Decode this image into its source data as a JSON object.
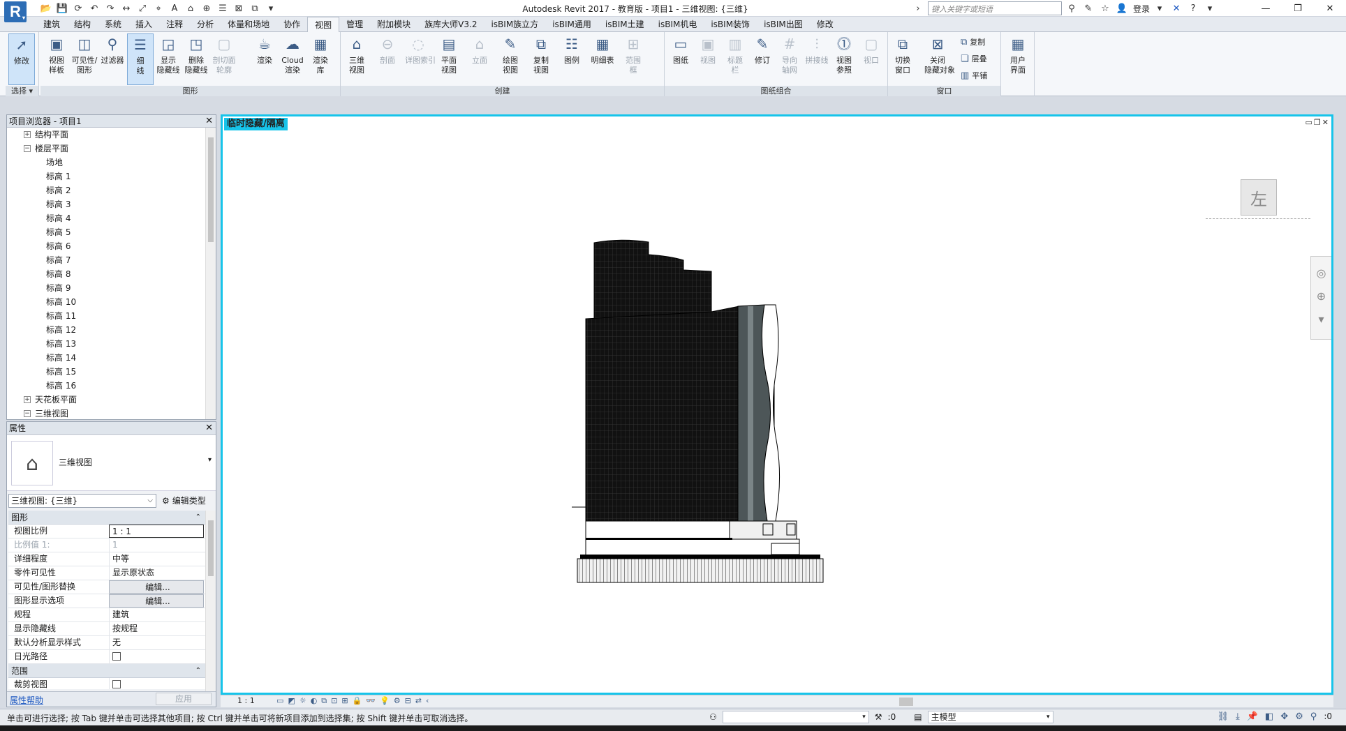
{
  "app": {
    "logo": "R",
    "window_title": "Autodesk Revit 2017 - 教育版 -    项目1 - 三维视图: {三维}",
    "search_placeholder": "键入关键字或短语",
    "login": "登录"
  },
  "tabs": [
    "建筑",
    "结构",
    "系统",
    "插入",
    "注释",
    "分析",
    "体量和场地",
    "协作",
    "视图",
    "管理",
    "附加模块",
    "族库大师V3.2",
    "isBIM族立方",
    "isBIM通用",
    "isBIM土建",
    "isBIM机电",
    "isBIM装饰",
    "isBIM出图",
    "修改"
  ],
  "active_tab": "视图",
  "ribbon": {
    "select_group": {
      "button": "修改",
      "title": "选择"
    },
    "graphics_group": {
      "title": "图形",
      "buttons": [
        {
          "label": "视图\n样板",
          "icon": "view-template-icon",
          "dim": false
        },
        {
          "label": "可见性/\n图形",
          "icon": "visibility-icon",
          "dim": false
        },
        {
          "label": "过滤器",
          "icon": "filter-icon",
          "dim": false
        },
        {
          "label": "细\n线",
          "icon": "thin-lines-icon",
          "dim": false,
          "active": true
        },
        {
          "label": "显示\n隐藏线",
          "icon": "show-hidden-icon",
          "dim": false
        },
        {
          "label": "删除\n隐藏线",
          "icon": "remove-hidden-icon",
          "dim": false
        },
        {
          "label": "剖切面\n轮廓",
          "icon": "cut-profile-icon",
          "dim": true
        }
      ]
    },
    "presentation_group": {
      "buttons": [
        {
          "label": "渲染",
          "icon": "render-icon",
          "dim": false
        },
        {
          "label": "Cloud\n渲染",
          "icon": "cloud-render-icon",
          "dim": false
        },
        {
          "label": "渲染\n库",
          "icon": "render-gallery-icon",
          "dim": false
        }
      ]
    },
    "create_group": {
      "title": "创建",
      "buttons": [
        {
          "label": "三维\n视图",
          "icon": "3d-view-icon",
          "dim": false
        },
        {
          "label": "剖面",
          "icon": "section-icon",
          "dim": true
        },
        {
          "label": "详图索引",
          "icon": "callout-icon",
          "dim": true
        },
        {
          "label": "平面\n视图",
          "icon": "plan-view-icon",
          "dim": false
        },
        {
          "label": "立面",
          "icon": "elevation-icon",
          "dim": true
        },
        {
          "label": "绘图\n视图",
          "icon": "drafting-view-icon",
          "dim": false
        },
        {
          "label": "复制\n视图",
          "icon": "duplicate-view-icon",
          "dim": false
        },
        {
          "label": "图例",
          "icon": "legend-icon",
          "dim": false
        },
        {
          "label": "明细表",
          "icon": "schedule-icon",
          "dim": false
        },
        {
          "label": "范围\n框",
          "icon": "scope-box-icon",
          "dim": true
        }
      ]
    },
    "sheet_group": {
      "title": "图纸组合",
      "buttons": [
        {
          "label": "图纸",
          "icon": "sheet-icon",
          "dim": false
        },
        {
          "label": "视图",
          "icon": "place-view-icon",
          "dim": true
        },
        {
          "label": "标题\n栏",
          "icon": "title-block-icon",
          "dim": true
        },
        {
          "label": "修订",
          "icon": "revisions-icon",
          "dim": false
        },
        {
          "label": "导向\n轴网",
          "icon": "guide-grid-icon",
          "dim": true
        },
        {
          "label": "拼接线",
          "icon": "matchline-icon",
          "dim": true
        },
        {
          "label": "视图\n参照",
          "icon": "view-reference-icon",
          "dim": false
        },
        {
          "label": "视口",
          "icon": "viewport-icon",
          "dim": true
        }
      ]
    },
    "window_group": {
      "title": "窗口",
      "buttons": [
        {
          "label": "切换\n窗口",
          "icon": "switch-window-icon",
          "dim": false
        },
        {
          "label": "关闭\n隐藏对象",
          "icon": "close-hidden-icon",
          "dim": false
        }
      ],
      "small": [
        "复制",
        "层叠",
        "平铺"
      ]
    },
    "ui_group": {
      "label": "用户\n界面"
    }
  },
  "browser": {
    "title": "项目浏览器 - 项目1",
    "items": [
      {
        "label": "结构平面",
        "level": 1,
        "exp": "+"
      },
      {
        "label": "楼层平面",
        "level": 1,
        "exp": "-"
      },
      {
        "label": "场地",
        "level": 2
      },
      {
        "label": "标高 1",
        "level": 2
      },
      {
        "label": "标高 2",
        "level": 2
      },
      {
        "label": "标高 3",
        "level": 2
      },
      {
        "label": "标高 4",
        "level": 2
      },
      {
        "label": "标高 5",
        "level": 2
      },
      {
        "label": "标高 6",
        "level": 2
      },
      {
        "label": "标高 7",
        "level": 2
      },
      {
        "label": "标高 8",
        "level": 2
      },
      {
        "label": "标高 9",
        "level": 2
      },
      {
        "label": "标高 10",
        "level": 2
      },
      {
        "label": "标高 11",
        "level": 2
      },
      {
        "label": "标高 12",
        "level": 2
      },
      {
        "label": "标高 13",
        "level": 2
      },
      {
        "label": "标高 14",
        "level": 2
      },
      {
        "label": "标高 15",
        "level": 2
      },
      {
        "label": "标高 16",
        "level": 2
      },
      {
        "label": "天花板平面",
        "level": 1,
        "exp": "+"
      },
      {
        "label": "三维视图",
        "level": 1,
        "exp": "-"
      }
    ]
  },
  "properties": {
    "title": "属性",
    "type_name": "三维视图",
    "view_selector": "三维视图: {三维}",
    "edit_type": "编辑类型",
    "sections": [
      {
        "name": "图形",
        "rows": [
          {
            "k": "视图比例",
            "v": "1 : 1",
            "kind": "input"
          },
          {
            "k": "比例值 1:",
            "v": "1",
            "kind": "text",
            "dim": true
          },
          {
            "k": "详细程度",
            "v": "中等",
            "kind": "text"
          },
          {
            "k": "零件可见性",
            "v": "显示原状态",
            "kind": "text"
          },
          {
            "k": "可见性/图形替换",
            "v": "编辑...",
            "kind": "btn"
          },
          {
            "k": "图形显示选项",
            "v": "编辑...",
            "kind": "btn"
          },
          {
            "k": "规程",
            "v": "建筑",
            "kind": "text"
          },
          {
            "k": "显示隐藏线",
            "v": "按规程",
            "kind": "text"
          },
          {
            "k": "默认分析显示样式",
            "v": "无",
            "kind": "text"
          },
          {
            "k": "日光路径",
            "v": "",
            "kind": "check"
          }
        ]
      },
      {
        "name": "范围",
        "rows": [
          {
            "k": "裁剪视图",
            "v": "",
            "kind": "check"
          }
        ]
      }
    ],
    "help": "属性帮助",
    "apply": "应用"
  },
  "view": {
    "temp_label": "临时隐藏/隔离",
    "viewcube_face": "左",
    "scale": "1 : 1"
  },
  "status": {
    "message": "单击可进行选择; 按 Tab 键并单击可选择其他项目; 按 Ctrl 键并单击可将新项目添加到选择集; 按 Shift 键并单击可取消选择。",
    "workset_count": ":0",
    "model": "主模型",
    "filter_count": ":0"
  }
}
